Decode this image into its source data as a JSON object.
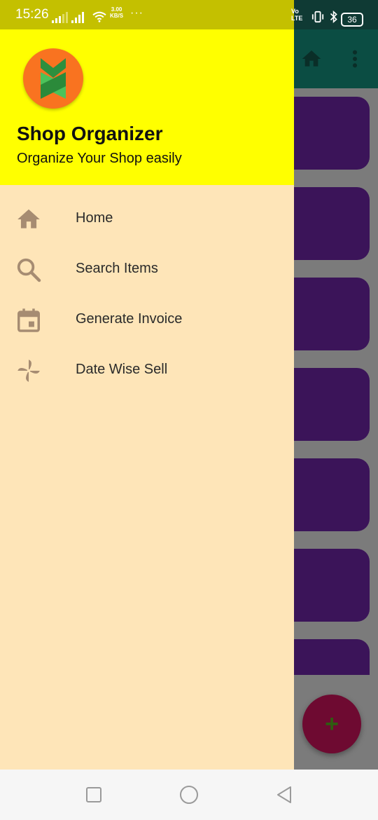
{
  "status_bar": {
    "time": "15:26",
    "net_speed_value": "3.00",
    "net_speed_unit": "KB/S",
    "dots": "···",
    "volte_line1": "Vo",
    "volte_line2": "LTE",
    "battery": "36"
  },
  "drawer": {
    "title": "Shop Organizer",
    "subtitle": "Organize Your Shop easily",
    "menu": [
      {
        "label": "Home",
        "icon": "home-icon"
      },
      {
        "label": "Search Items",
        "icon": "search-icon"
      },
      {
        "label": "Generate Invoice",
        "icon": "calendar-icon"
      },
      {
        "label": "Date Wise Sell",
        "icon": "pinwheel-icon"
      }
    ]
  },
  "fab": {
    "label": "+"
  },
  "colors": {
    "header": "#ffff00",
    "drawer_bg": "#fee5b8",
    "card": "#3b1459",
    "fab": "#6e0a31",
    "toolbar": "#0b4d43",
    "icon": "#a68c72"
  }
}
